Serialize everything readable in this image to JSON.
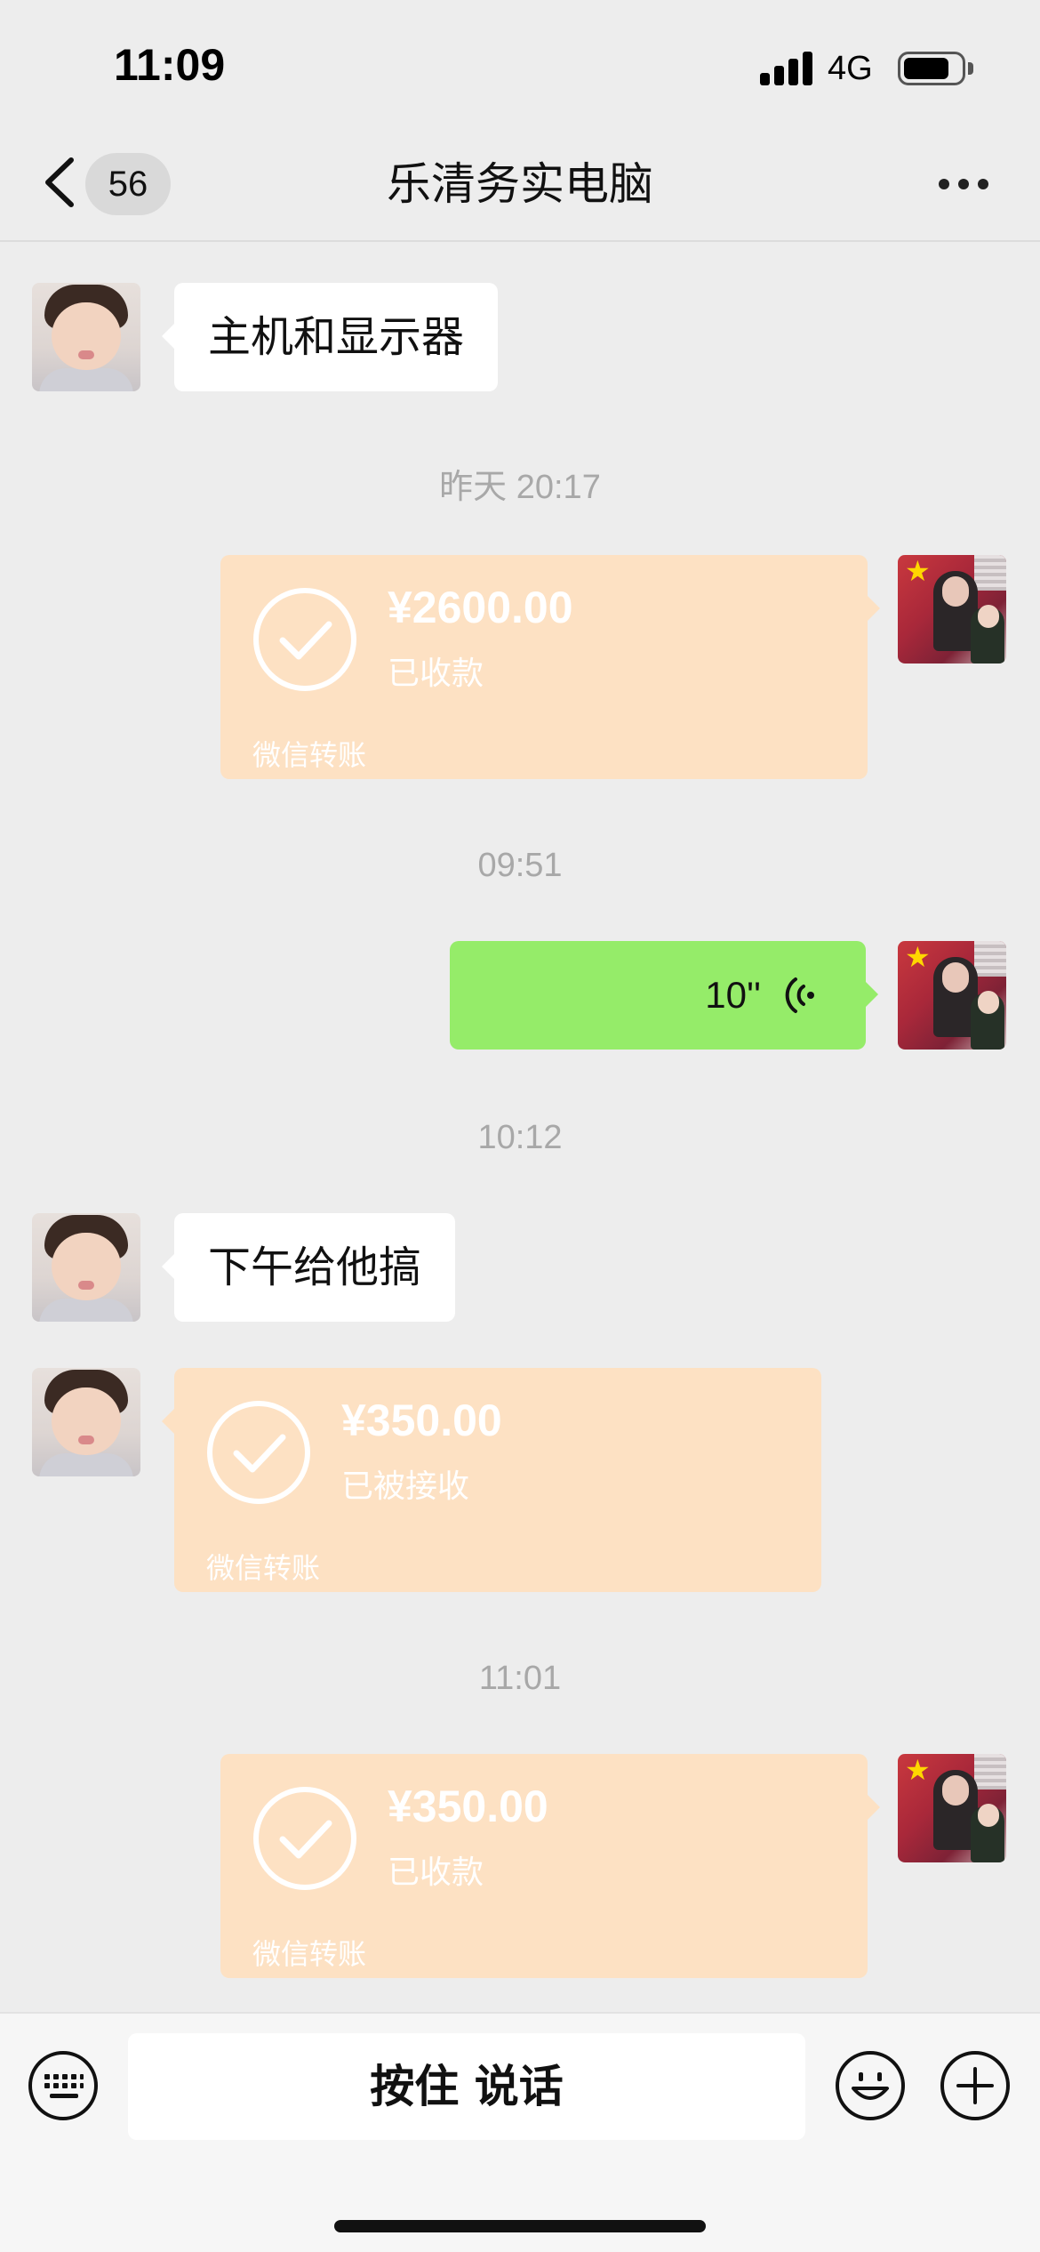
{
  "status_bar": {
    "time": "11:09",
    "network": "4G"
  },
  "header": {
    "unread_count": "56",
    "title": "乐清务实电脑"
  },
  "messages": {
    "m1_text": "主机和显示器",
    "t1": "昨天 20:17",
    "transfer1": {
      "amount": "¥2600.00",
      "status": "已收款",
      "label": "微信转账"
    },
    "t2": "09:51",
    "voice": {
      "duration": "10''"
    },
    "t3": "10:12",
    "m2_text": "下午给他搞",
    "transfer2": {
      "amount": "¥350.00",
      "status": "已被接收",
      "label": "微信转账"
    },
    "t4": "11:01",
    "transfer3": {
      "amount": "¥350.00",
      "status": "已收款",
      "label": "微信转账"
    }
  },
  "input_bar": {
    "hold_to_talk": "按住 说话"
  },
  "icons": [
    "back-chevron-icon",
    "more-icon",
    "check-icon",
    "voice-wave-icon",
    "keyboard-icon",
    "emoji-icon",
    "plus-icon"
  ],
  "colors": {
    "background": "#ededed",
    "transfer_bubble": "#fde1c3",
    "voice_bubble": "#95ec69"
  }
}
